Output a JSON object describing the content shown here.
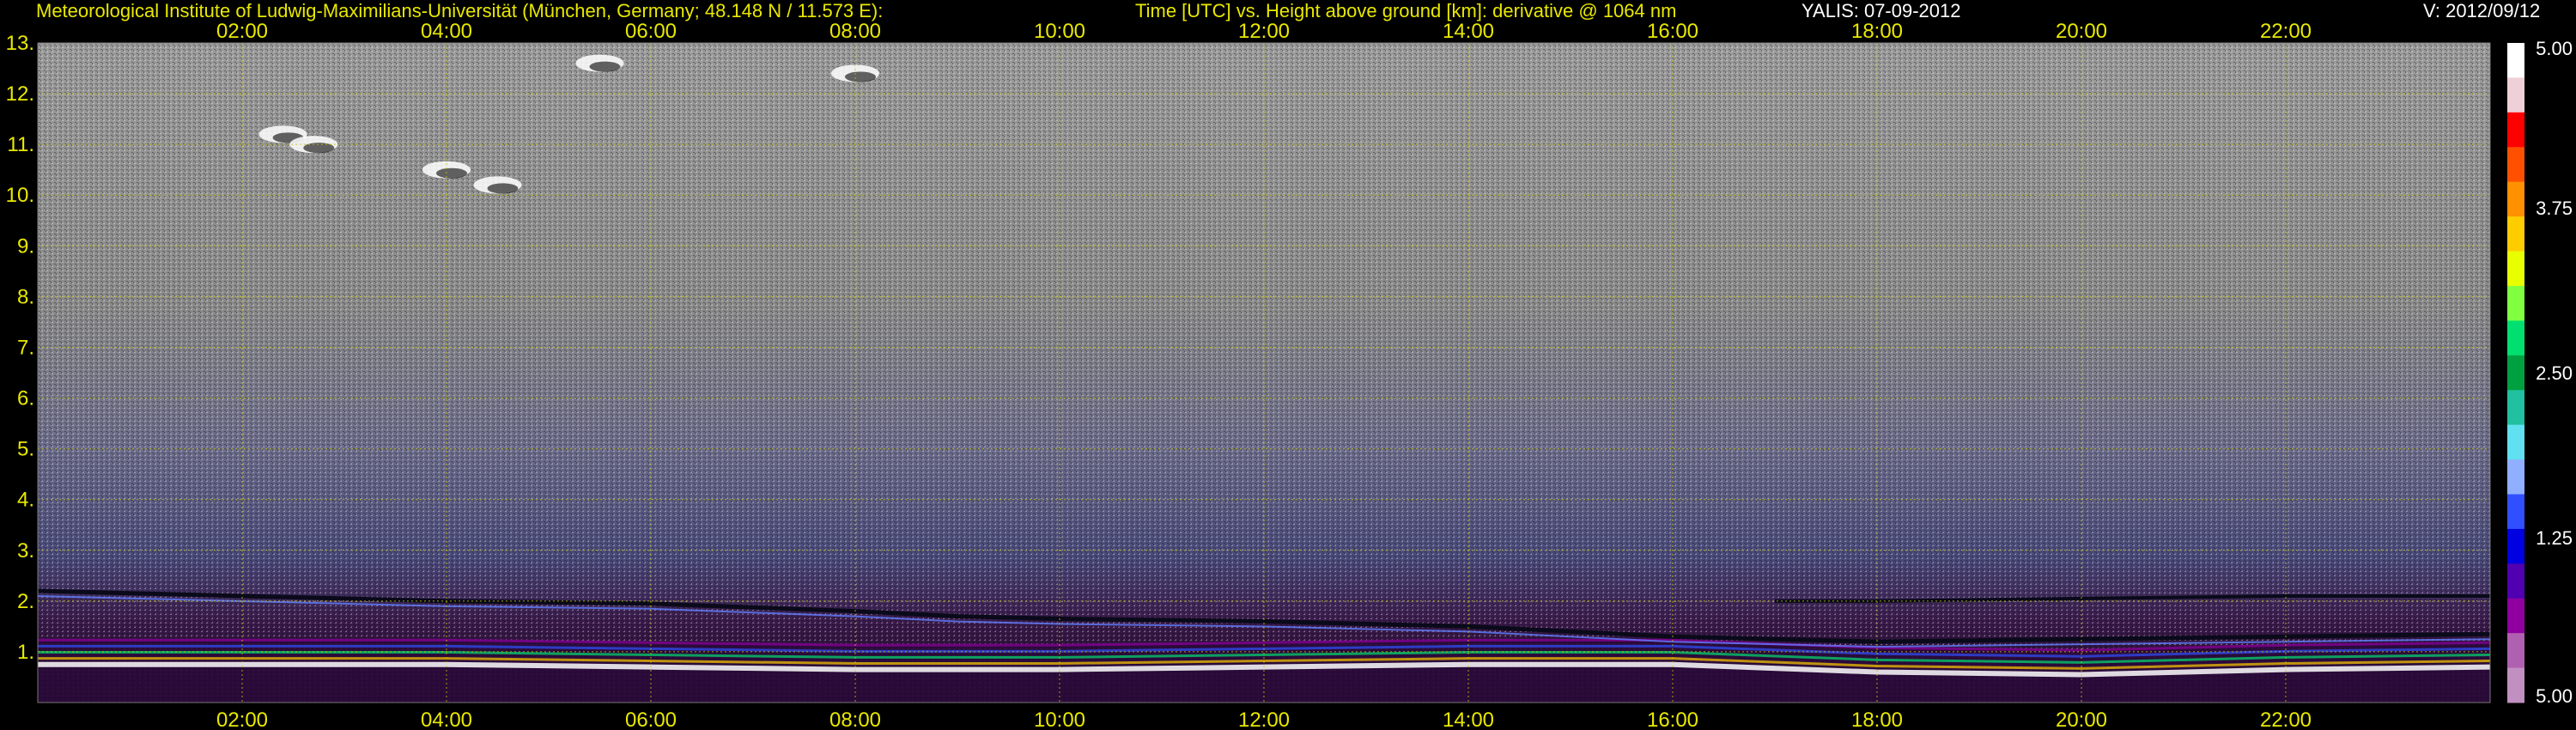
{
  "header": {
    "institute": "Meteorological Institute of Ludwig-Maximilians-Universität (München, Germany; 48.148 N / 11.573 E):",
    "title": "Time [UTC] vs. Height above ground [km]: derivative @ 1064 nm",
    "instrument": "YALIS: 07-09-2012",
    "version": "V: 2012/09/12"
  },
  "colors": {
    "axis_text": "#e8e800",
    "grid": "#c8c800",
    "background": "#000000"
  },
  "chart_data": {
    "type": "heatmap",
    "title": "Time [UTC] vs. Height above ground [km]: derivative @ 1064 nm",
    "xlabel": "Time [UTC]",
    "ylabel": "Height above ground [km]",
    "xlim": [
      0,
      24
    ],
    "ylim": [
      0,
      13
    ],
    "x_ticks": [
      {
        "value": 2,
        "label": "02:00"
      },
      {
        "value": 4,
        "label": "04:00"
      },
      {
        "value": 6,
        "label": "06:00"
      },
      {
        "value": 8,
        "label": "08:00"
      },
      {
        "value": 10,
        "label": "10:00"
      },
      {
        "value": 12,
        "label": "12:00"
      },
      {
        "value": 14,
        "label": "14:00"
      },
      {
        "value": 16,
        "label": "16:00"
      },
      {
        "value": 18,
        "label": "18:00"
      },
      {
        "value": 20,
        "label": "20:00"
      },
      {
        "value": 22,
        "label": "22:00"
      }
    ],
    "y_ticks": [
      {
        "value": 1,
        "label": "1."
      },
      {
        "value": 2,
        "label": "2."
      },
      {
        "value": 3,
        "label": "3."
      },
      {
        "value": 4,
        "label": "4."
      },
      {
        "value": 5,
        "label": "5."
      },
      {
        "value": 6,
        "label": "6."
      },
      {
        "value": 7,
        "label": "7."
      },
      {
        "value": 8,
        "label": "8."
      },
      {
        "value": 9,
        "label": "9."
      },
      {
        "value": 10,
        "label": "10."
      },
      {
        "value": 11,
        "label": "11."
      },
      {
        "value": 12,
        "label": "12."
      },
      {
        "value": 13,
        "label": "13."
      }
    ],
    "grid": true,
    "colorbar": {
      "ticks": [
        {
          "value": 5.0,
          "label": "5.00"
        },
        {
          "value": 3.75,
          "label": "3.75"
        },
        {
          "value": 2.5,
          "label": "2.50"
        },
        {
          "value": 1.25,
          "label": "1.25"
        },
        {
          "value": 0,
          "label": "5.00"
        }
      ],
      "colors": [
        "#ffffff",
        "#f0d0d8",
        "#ff0000",
        "#ff5000",
        "#ff9000",
        "#ffcc00",
        "#e8ff00",
        "#80ff40",
        "#00e070",
        "#00a040",
        "#20c0a0",
        "#60e0f0",
        "#90b0ff",
        "#3050ff",
        "#0000e0",
        "#5000b0",
        "#9000a0",
        "#b060b0",
        "#c090c0"
      ]
    },
    "series": [
      {
        "layer": "boundary_layer_top",
        "x": [
          0,
          2,
          4,
          6,
          8,
          9,
          10,
          12,
          14,
          16,
          18,
          20,
          22,
          24
        ],
        "y": [
          2.2,
          2.1,
          2.0,
          1.95,
          1.8,
          1.7,
          1.65,
          1.6,
          1.5,
          1.3,
          1.2,
          1.25,
          1.3,
          1.35
        ]
      },
      {
        "layer": "residual_layer_top",
        "x": [
          17,
          18,
          20,
          22,
          24
        ],
        "y": [
          2.0,
          2.0,
          2.05,
          2.1,
          2.1
        ]
      },
      {
        "layer": "aerosol_layer_base",
        "x": [
          0,
          2,
          4,
          6,
          8,
          9,
          10,
          12,
          14,
          16,
          18,
          20,
          22,
          24
        ],
        "y": [
          0.9,
          0.9,
          0.9,
          0.85,
          0.8,
          0.8,
          0.8,
          0.85,
          0.9,
          0.9,
          0.75,
          0.7,
          0.8,
          0.85
        ]
      },
      {
        "layer": "cloud_patches",
        "x": [
          2.4,
          2.7,
          4.0,
          4.5,
          5.5,
          8.0
        ],
        "y": [
          11.2,
          11.0,
          10.5,
          10.2,
          12.6,
          12.4
        ]
      }
    ]
  }
}
